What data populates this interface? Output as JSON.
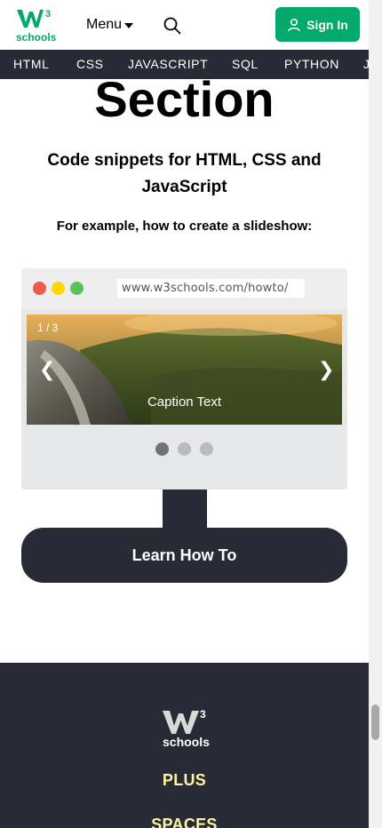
{
  "header": {
    "logo_text": "schools",
    "menu_label": "Menu",
    "signin_label": "Sign In"
  },
  "nav": {
    "items": [
      "HTML",
      "CSS",
      "JAVASCRIPT",
      "SQL",
      "PYTHON",
      "J"
    ]
  },
  "main": {
    "section_title": "Section",
    "subtitle": "Code snippets for HTML, CSS and JavaScript",
    "example_text": "For example, how to create a slideshow:",
    "browser": {
      "url": "www.w3schools.com/howto/",
      "slide_counter": "1 / 3",
      "slide_caption": "Caption Text",
      "prev_arrow": "❮",
      "next_arrow": "❯",
      "active_slide": 1,
      "slide_count": 3
    },
    "learn_button": "Learn How To"
  },
  "footer": {
    "logo_text": "schools",
    "links": [
      "PLUS",
      "SPACES"
    ]
  },
  "colors": {
    "brand_green": "#04AA6D",
    "dark": "#282A35",
    "footer_link": "#FFF4A3",
    "dot_red": "#ED594A",
    "dot_yellow": "#FDD800",
    "dot_green": "#5AC05A"
  }
}
